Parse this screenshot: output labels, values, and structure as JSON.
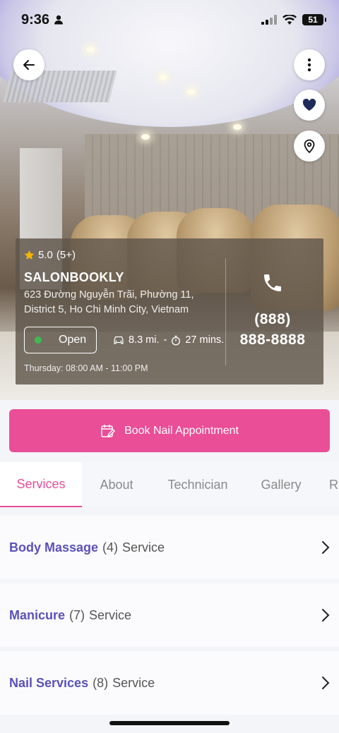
{
  "status_bar": {
    "time": "9:36",
    "battery": "51"
  },
  "hero": {
    "back_icon": "arrow-left-icon",
    "more_icon": "dots-vertical-icon",
    "favorite_icon": "heart-icon",
    "location_icon": "map-pin-icon"
  },
  "salon": {
    "rating": "5.0",
    "rating_count": "(5+)",
    "name": "SALONBOOKLY",
    "address_line1": "623 Đường Nguyễn Trãi, Phường 11,",
    "address_line2": "District 5, Ho Chi Minh City, Vietnam",
    "open_status": "Open",
    "distance": "8.3 mi.",
    "separator": "-",
    "drive_time": "27 mins.",
    "hours": "Thursday: 08:00 AM - 11:00 PM",
    "phone_line1": "(888)",
    "phone_line2": "888-8888"
  },
  "book_button": {
    "label": "Book Nail Appointment",
    "icon": "calendar-edit-icon"
  },
  "tabs": [
    {
      "label": "Services",
      "active": true
    },
    {
      "label": "About"
    },
    {
      "label": "Technician"
    },
    {
      "label": "Gallery"
    },
    {
      "label": "R"
    }
  ],
  "services": [
    {
      "name": "Body Massage",
      "count": "(4)",
      "suffix": "Service"
    },
    {
      "name": "Manicure",
      "count": "(7)",
      "suffix": "Service"
    },
    {
      "name": "Nail Services",
      "count": "(8)",
      "suffix": "Service"
    }
  ],
  "colors": {
    "accent": "#e94e97",
    "service_name": "#5a52b8",
    "open_dot": "#3fb950"
  }
}
